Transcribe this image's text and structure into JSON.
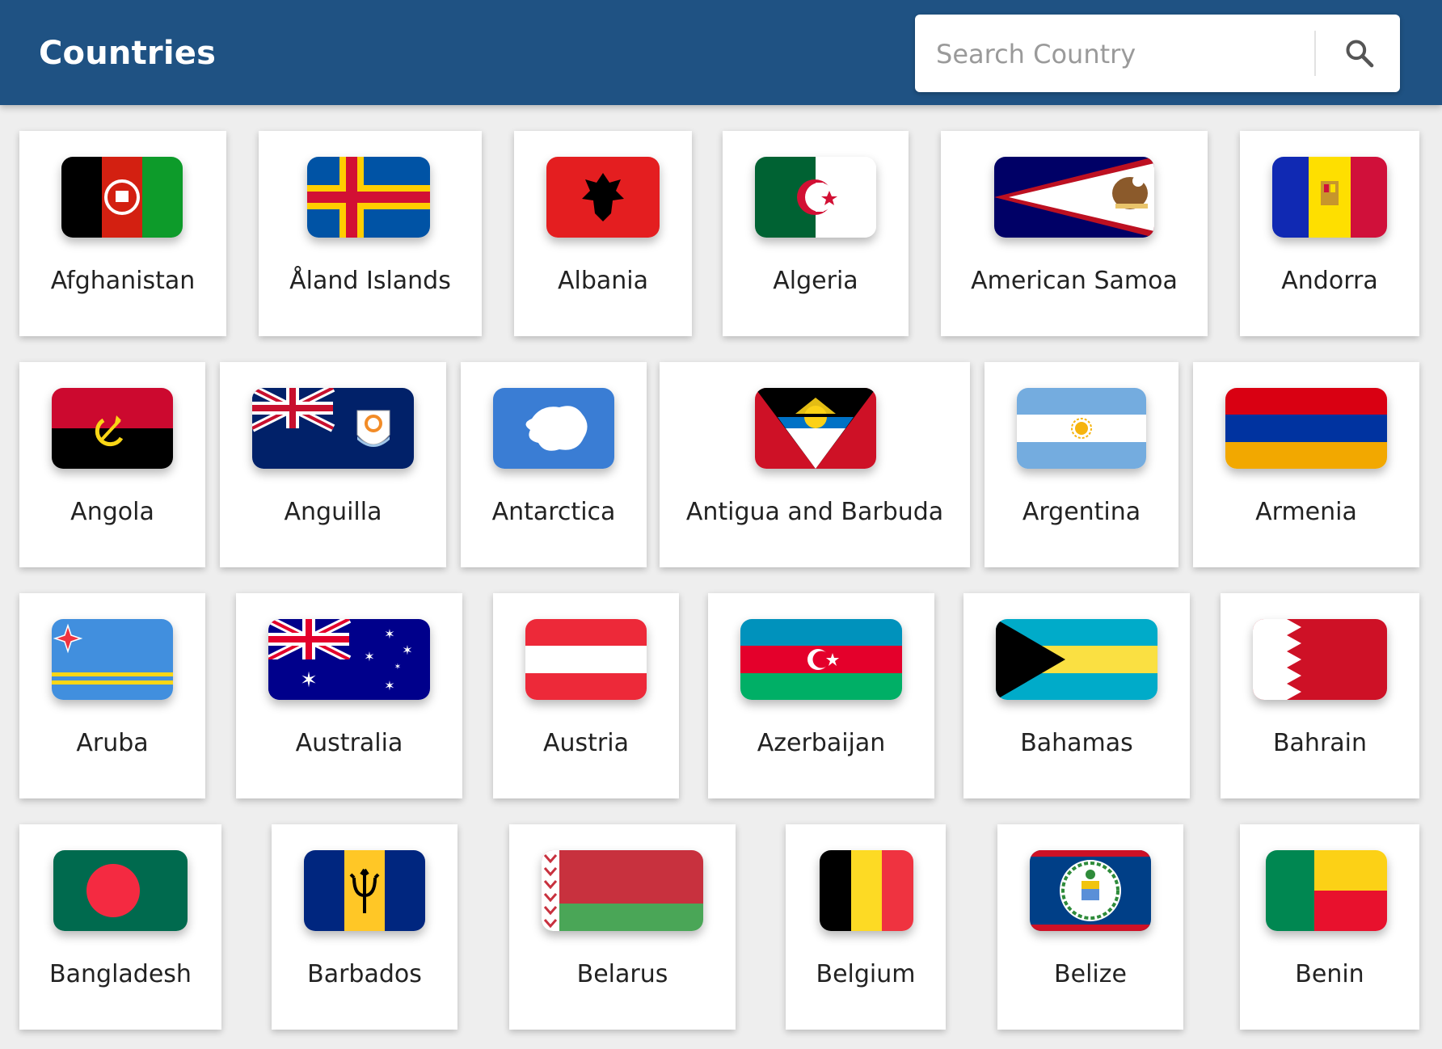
{
  "header": {
    "title": "Countries",
    "search_placeholder": "Search Country"
  },
  "countries": [
    {
      "name": "Afghanistan",
      "flag": "afghanistan-flag"
    },
    {
      "name": "Åland Islands",
      "flag": "aland-islands-flag"
    },
    {
      "name": "Albania",
      "flag": "albania-flag"
    },
    {
      "name": "Algeria",
      "flag": "algeria-flag"
    },
    {
      "name": "American Samoa",
      "flag": "american-samoa-flag"
    },
    {
      "name": "Andorra",
      "flag": "andorra-flag"
    },
    {
      "name": "Angola",
      "flag": "angola-flag"
    },
    {
      "name": "Anguilla",
      "flag": "anguilla-flag"
    },
    {
      "name": "Antarctica",
      "flag": "antarctica-flag"
    },
    {
      "name": "Antigua and Barbuda",
      "flag": "antigua-and-barbuda-flag"
    },
    {
      "name": "Argentina",
      "flag": "argentina-flag"
    },
    {
      "name": "Armenia",
      "flag": "armenia-flag"
    },
    {
      "name": "Aruba",
      "flag": "aruba-flag"
    },
    {
      "name": "Australia",
      "flag": "australia-flag"
    },
    {
      "name": "Austria",
      "flag": "austria-flag"
    },
    {
      "name": "Azerbaijan",
      "flag": "azerbaijan-flag"
    },
    {
      "name": "Bahamas",
      "flag": "bahamas-flag"
    },
    {
      "name": "Bahrain",
      "flag": "bahrain-flag"
    },
    {
      "name": "Bangladesh",
      "flag": "bangladesh-flag"
    },
    {
      "name": "Barbados",
      "flag": "barbados-flag"
    },
    {
      "name": "Belarus",
      "flag": "belarus-flag"
    },
    {
      "name": "Belgium",
      "flag": "belgium-flag"
    },
    {
      "name": "Belize",
      "flag": "belize-flag"
    },
    {
      "name": "Benin",
      "flag": "benin-flag"
    }
  ],
  "colors": {
    "header_bg": "#1f5283",
    "header_text": "#ffffff",
    "page_bg": "#eeeeee",
    "card_bg": "#ffffff"
  }
}
